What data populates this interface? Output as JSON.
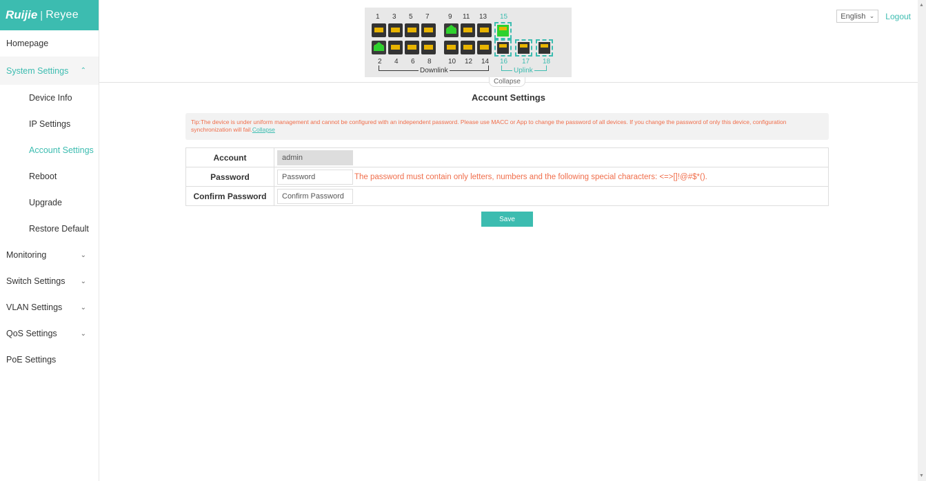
{
  "brand": {
    "logo_text": "Ruijie",
    "logo_separator": "|",
    "logo_sub": "Reyee"
  },
  "sidebar": {
    "homepage": "Homepage",
    "system_settings": "System Settings",
    "children": [
      "Device Info",
      "IP Settings",
      "Account Settings",
      "Reboot",
      "Upgrade",
      "Restore Default"
    ],
    "groups": [
      "Monitoring",
      "Switch Settings",
      "VLAN Settings",
      "QoS Settings"
    ],
    "poe": "PoE Settings",
    "active_child": "Account Settings"
  },
  "topbar": {
    "language": "English",
    "logout": "Logout"
  },
  "panel": {
    "top_ports": [
      "1",
      "3",
      "5",
      "7",
      "9",
      "11",
      "13",
      "15"
    ],
    "bottom_ports": [
      "2",
      "4",
      "6",
      "8",
      "10",
      "12",
      "14",
      "16",
      "17",
      "18"
    ],
    "downlink_label": "Downlink",
    "uplink_label": "Uplink",
    "collapse": "Collapse",
    "active_ports": [
      "9",
      "15",
      "2"
    ]
  },
  "page": {
    "title": "Account Settings",
    "tip": "Tip:The device is under uniform management and cannot be configured with an independent password. Please use MACC or App to change the password of all devices. If you change the password of only this device, configuration synchronization will fail.",
    "tip_link": "Collapse"
  },
  "form": {
    "account_label": "Account",
    "account_value": "admin",
    "password_label": "Password",
    "password_placeholder": "Password",
    "password_hint": "The password must contain only letters, numbers and the following special characters: <=>[]!@#$*().",
    "confirm_label": "Confirm Password",
    "confirm_placeholder": "Confirm Password",
    "save": "Save"
  },
  "colors": {
    "accent": "#3cbcb0",
    "warning": "#f06d4a",
    "port_active": "#2ed12e",
    "port_led": "#e8b400"
  }
}
